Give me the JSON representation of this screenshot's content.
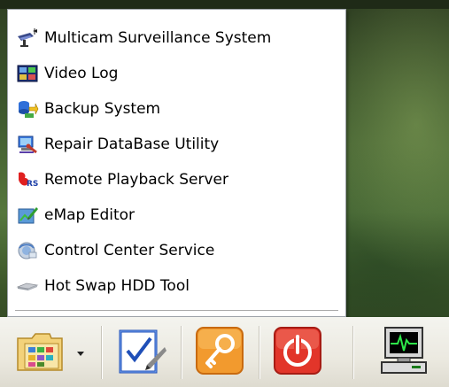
{
  "menu": {
    "items": [
      {
        "label": "Multicam Surveillance System",
        "icon": "surveillance-camera-icon"
      },
      {
        "label": "Video Log",
        "icon": "video-log-icon"
      },
      {
        "label": "Backup System",
        "icon": "backup-icon"
      },
      {
        "label": "Repair DataBase Utility",
        "icon": "repair-database-icon"
      },
      {
        "label": "Remote Playback Server",
        "icon": "remote-playback-icon"
      },
      {
        "label": "eMap Editor",
        "icon": "emap-editor-icon"
      },
      {
        "label": "Control Center Service",
        "icon": "control-center-icon"
      },
      {
        "label": "Hot Swap HDD Tool",
        "icon": "hot-swap-hdd-icon"
      }
    ]
  },
  "taskbar": {
    "buttons": [
      {
        "icon": "folder-menu-icon"
      },
      {
        "icon": "dropdown-arrow-icon"
      },
      {
        "icon": "checklist-icon"
      },
      {
        "icon": "key-icon"
      },
      {
        "icon": "power-icon"
      },
      {
        "icon": "monitor-icon"
      }
    ]
  },
  "colors": {
    "menu_bg": "#ffffff",
    "taskbar_bg": "#ebe9e0",
    "power_red": "#e2352a",
    "key_orange": "#f29a2e"
  }
}
